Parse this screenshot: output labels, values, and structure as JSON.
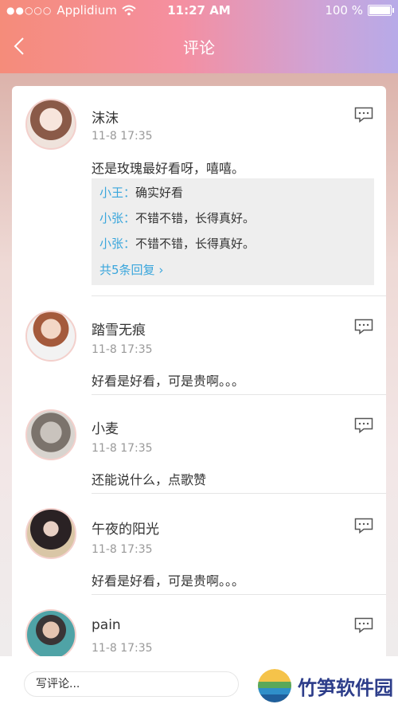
{
  "status_bar": {
    "carrier": "Applidium",
    "time": "11:27 AM",
    "battery": "100 %"
  },
  "nav": {
    "title": "评论"
  },
  "comments": [
    {
      "name": "沫沫",
      "time": "11-8  17:35",
      "text": "还是玫瑰最好看呀，嘻嘻。",
      "replies": [
        {
          "who": "小王：",
          "text": "确实好看"
        },
        {
          "who": "小张：",
          "text": "不错不错，长得真好。"
        },
        {
          "who": "小张：",
          "text": "不错不错，长得真好。"
        }
      ],
      "more": "共5条回复"
    },
    {
      "name": "踏雪无痕",
      "time": "11-8  17:35",
      "text": "好看是好看，可是贵啊。。。"
    },
    {
      "name": "小麦",
      "time": "11-8  17:35",
      "text": "还能说什么，点歌赞"
    },
    {
      "name": "午夜的阳光",
      "time": "11-8  17:35",
      "text": "好看是好看，可是贵啊。。。"
    },
    {
      "name": "pain",
      "time": "11-8  17:35",
      "text": ""
    }
  ],
  "input": {
    "placeholder": "写评论..."
  },
  "watermark": {
    "text": "竹笋软件园"
  },
  "colors": {
    "accent": "#3aa6dc",
    "header_start": "#f58c7a",
    "header_end": "#b7aae8"
  }
}
